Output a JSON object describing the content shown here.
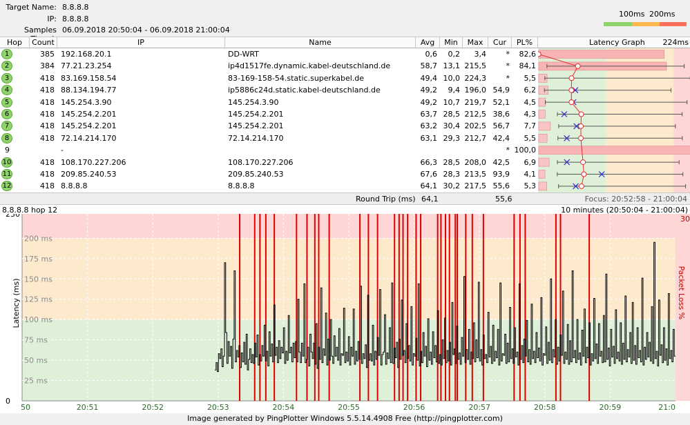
{
  "header": {
    "target_label": "Target Name:",
    "target_value": "8.8.8.8",
    "ip_label": "IP:",
    "ip_value": "8.8.8.8",
    "samples_label": "Samples Timed:",
    "samples_value": "06.09.2018 20:50:04 - 06.09.2018 21:00:04",
    "scale_100": "100ms",
    "scale_200": "200ms",
    "colors": {
      "good": "#8fd36a",
      "warn": "#ffb84d",
      "bad": "#ff6f5c"
    }
  },
  "table": {
    "columns": [
      "Hop",
      "Count",
      "IP",
      "Name",
      "Avg",
      "Min",
      "Max",
      "Cur",
      "PL%",
      "Latency Graph",
      "224ms"
    ],
    "rows": [
      {
        "hop": "1",
        "count": "385",
        "ip": "192.168.20.1",
        "name": "DD-WRT",
        "avg": "0,6",
        "min": "0,2",
        "max": "3,4",
        "cur": "*",
        "pl": "82,6"
      },
      {
        "hop": "2",
        "count": "384",
        "ip": "77.21.23.254",
        "name": "ip4d1517fe.dynamic.kabel-deutschland.de",
        "avg": "58,7",
        "min": "13,1",
        "max": "215,5",
        "cur": "*",
        "pl": "84,1"
      },
      {
        "hop": "3",
        "count": "418",
        "ip": "83.169.158.54",
        "name": "83-169-158-54.static.superkabel.de",
        "avg": "49,4",
        "min": "10,0",
        "max": "224,3",
        "cur": "*",
        "pl": "5,5"
      },
      {
        "hop": "4",
        "count": "418",
        "ip": "88.134.194.77",
        "name": "ip5886c24d.static.kabel-deutschland.de",
        "avg": "49,2",
        "min": "9,4",
        "max": "196,0",
        "cur": "54,9",
        "pl": "6,2"
      },
      {
        "hop": "5",
        "count": "418",
        "ip": "145.254.3.90",
        "name": "145.254.3.90",
        "avg": "49,2",
        "min": "10,7",
        "max": "219,7",
        "cur": "52,1",
        "pl": "4,5"
      },
      {
        "hop": "6",
        "count": "418",
        "ip": "145.254.2.201",
        "name": "145.254.2.201",
        "avg": "63,7",
        "min": "28,5",
        "max": "212,5",
        "cur": "38,6",
        "pl": "4,3"
      },
      {
        "hop": "7",
        "count": "418",
        "ip": "145.254.2.201",
        "name": "145.254.2.201",
        "avg": "63,2",
        "min": "30,4",
        "max": "202,5",
        "cur": "56,7",
        "pl": "7,7"
      },
      {
        "hop": "8",
        "count": "418",
        "ip": "72.14.214.170",
        "name": "72.14.214.170",
        "avg": "63,1",
        "min": "29,3",
        "max": "212,7",
        "cur": "42,4",
        "pl": "5,5"
      },
      {
        "hop": "9",
        "count": "",
        "ip": "-",
        "name": "",
        "avg": "",
        "min": "",
        "max": "",
        "cur": "*",
        "pl": "100,0"
      },
      {
        "hop": "10",
        "count": "418",
        "ip": "108.170.227.206",
        "name": "108.170.227.206",
        "avg": "66,3",
        "min": "28,5",
        "max": "208,0",
        "cur": "42,5",
        "pl": "6,9"
      },
      {
        "hop": "11",
        "count": "418",
        "ip": "209.85.240.53",
        "name": "209.85.240.53",
        "avg": "67,6",
        "min": "28,3",
        "max": "213,5",
        "cur": "93,9",
        "pl": "4,1"
      },
      {
        "hop": "12",
        "count": "418",
        "ip": "8.8.8.8",
        "name": "8.8.8.8",
        "avg": "64,1",
        "min": "30,2",
        "max": "217,5",
        "cur": "55,6",
        "pl": "5,3"
      }
    ],
    "footer_label": "Round Trip (ms)",
    "footer_avg": "64,1",
    "footer_cur": "55,6",
    "focus": "Focus: 20:52:58 - 21:00:04"
  },
  "chart_header": {
    "left": "8.8.8.8 hop 12",
    "right": "10 minutes (20:50:04 - 21:00:04)"
  },
  "chart_data": {
    "type": "line",
    "ylabel": "Latency (ms)",
    "y2label": "Packet Loss %",
    "ylim": [
      0,
      230
    ],
    "y2max": "30",
    "ytick_labels": [
      "230",
      "200 ms",
      "175 ms",
      "150 ms",
      "125 ms",
      "100 ms",
      "75 ms",
      "50 ms",
      "25 ms",
      "0"
    ],
    "xtick_labels": [
      "50",
      "20:51",
      "20:52",
      "20:53",
      "20:54",
      "20:55",
      "20:56",
      "20:57",
      "20:58",
      "20:59",
      "21:0"
    ],
    "xlim_minutes": [
      50,
      60
    ],
    "data_start_minute": 52.95,
    "bands": [
      {
        "from": 0,
        "to": 100,
        "color": "#dff0d8"
      },
      {
        "from": 100,
        "to": 200,
        "color": "#fde9cc"
      },
      {
        "from": 200,
        "to": 230,
        "color": "#ffd6d6"
      }
    ],
    "packet_loss_minutes": [
      53.33,
      53.56,
      53.64,
      53.73,
      53.86,
      54.2,
      54.36,
      54.48,
      54.54,
      54.7,
      55.17,
      55.3,
      55.44,
      55.7,
      55.77,
      55.83,
      55.9,
      56.03,
      56.1,
      56.36,
      56.41,
      56.48,
      56.54,
      56.63,
      56.66,
      56.79,
      56.89,
      57.06,
      57.53,
      57.62,
      57.7,
      58.17,
      58.24,
      58.68
    ],
    "series_samples_ms": [
      38,
      47,
      36,
      58,
      52,
      64,
      42,
      55,
      170,
      84,
      46,
      73,
      55,
      67,
      40,
      76,
      160,
      48,
      62,
      54,
      68,
      41,
      59,
      48,
      72,
      45,
      82,
      38,
      51,
      64,
      47,
      57,
      46,
      71,
      54,
      81,
      44,
      57,
      49,
      68,
      55,
      93,
      49,
      61,
      43,
      85,
      55,
      70,
      48,
      118,
      56,
      66,
      47,
      74,
      52,
      66,
      59,
      90,
      46,
      61,
      50,
      105,
      59,
      66,
      48,
      71,
      53,
      73,
      48,
      125,
      60,
      47,
      71,
      55,
      144,
      47,
      51,
      66,
      43,
      82,
      60,
      52,
      71,
      45,
      95,
      40,
      66,
      51,
      139,
      47,
      64,
      56,
      108,
      44,
      76,
      50,
      100,
      55,
      46,
      80,
      55,
      66,
      50,
      89,
      44,
      58,
      56,
      114,
      47,
      60,
      49,
      79,
      44,
      66,
      55,
      113,
      45,
      61,
      49,
      73,
      51,
      141,
      46,
      58,
      52,
      69,
      41,
      130,
      50,
      58,
      49,
      93,
      44,
      61,
      51,
      78,
      56,
      137,
      44,
      57,
      60,
      106,
      45,
      59,
      52,
      90,
      47,
      145,
      46,
      65,
      53,
      72,
      41,
      76,
      51,
      124,
      56,
      62,
      47,
      95,
      52,
      68,
      49,
      116,
      44,
      58,
      55,
      77,
      50,
      144,
      43,
      61,
      47,
      84,
      55,
      67,
      42,
      101,
      50,
      60,
      45,
      85,
      53,
      68,
      48,
      111,
      46,
      57,
      44,
      75,
      52,
      102,
      47,
      62,
      49,
      72,
      44,
      121,
      57,
      64,
      46,
      92,
      51,
      59,
      45,
      78,
      55,
      153,
      47,
      63,
      51,
      88,
      45,
      60,
      52,
      96,
      48,
      75,
      53,
      146,
      49,
      63,
      44,
      81,
      52,
      57,
      47,
      109,
      54,
      67,
      46,
      93,
      49,
      61,
      53,
      88,
      44,
      145,
      49,
      58,
      56,
      82,
      46,
      71,
      48,
      115,
      52,
      64,
      46,
      90,
      54,
      60,
      44,
      144,
      51,
      68,
      47,
      76,
      55,
      99,
      48,
      63,
      45,
      119,
      52,
      61,
      47,
      84,
      53,
      65,
      49,
      127,
      44,
      58,
      56,
      91,
      46,
      72,
      50,
      150,
      47,
      63,
      54,
      100,
      45,
      66,
      49,
      81,
      56,
      135,
      46,
      60,
      51,
      94,
      45,
      74,
      48,
      160,
      53,
      62,
      47,
      100,
      51,
      59,
      44,
      87,
      55,
      113,
      47,
      66,
      53,
      96,
      44,
      58,
      49,
      126,
      52,
      70,
      46,
      95,
      55,
      61,
      47,
      105,
      48,
      156,
      51,
      65,
      43,
      88,
      54,
      67,
      46,
      112,
      52,
      60,
      49,
      96,
      45,
      71,
      51,
      129,
      48,
      63,
      54,
      84,
      46,
      121,
      50,
      68,
      45,
      90,
      53,
      62,
      48,
      151,
      44,
      66,
      51,
      84,
      54,
      72,
      49,
      116,
      46,
      195,
      52,
      61,
      43,
      124,
      56,
      69,
      47,
      90,
      50,
      64,
      44,
      132,
      52,
      62,
      48,
      88,
      55
    ]
  },
  "footer": "Image generated by PingPlotter Windows 5.5.14.4908 Free (http://pingplotter.com)"
}
